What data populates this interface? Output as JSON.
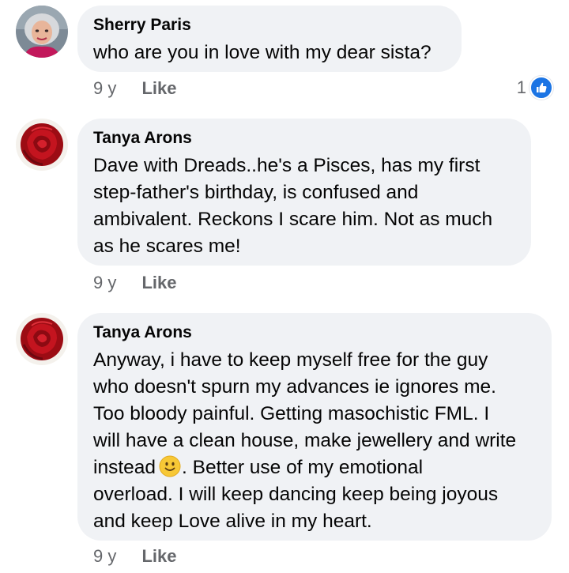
{
  "comments": [
    {
      "author": "Sherry Paris",
      "text": "who are you in love with my dear sista?",
      "age": "9 y",
      "like_label": "Like",
      "reaction_count": "1",
      "reaction_icon": "like-thumbs-up-icon",
      "avatar": "profile-photo-woman-white-hair"
    },
    {
      "author": "Tanya Arons",
      "lines": [
        "Dave with Dreads..he's a Pisces, has my first",
        "step-father's birthday, is confused and",
        "ambivalent.  Reckons I scare him. Not as much",
        "as he scares me!"
      ],
      "age": "9 y",
      "like_label": "Like",
      "avatar": "red-rose-icon"
    },
    {
      "author": "Tanya Arons",
      "lines": [
        "Anyway, i have to keep myself free for the guy",
        "who doesn't spurn my advances ie ignores me.",
        "Too bloody painful. Getting masochistic FML.  I",
        "will have a clean house, make jewellery and write"
      ],
      "line_emoji_before": "instead",
      "line_emoji_after": ". Better use of my emotional",
      "emoji": "slightly-smiling-face-emoji",
      "lines_after": [
        "overload.  I will keep dancing keep being joyous",
        "and keep Love alive in my heart."
      ],
      "age": "9 y",
      "like_label": "Like",
      "avatar": "red-rose-icon"
    }
  ],
  "colors": {
    "bubble": "#f0f2f5",
    "meta_text": "#65676b",
    "like_blue": "#1b74e4",
    "rose_red": "#b0101a"
  }
}
